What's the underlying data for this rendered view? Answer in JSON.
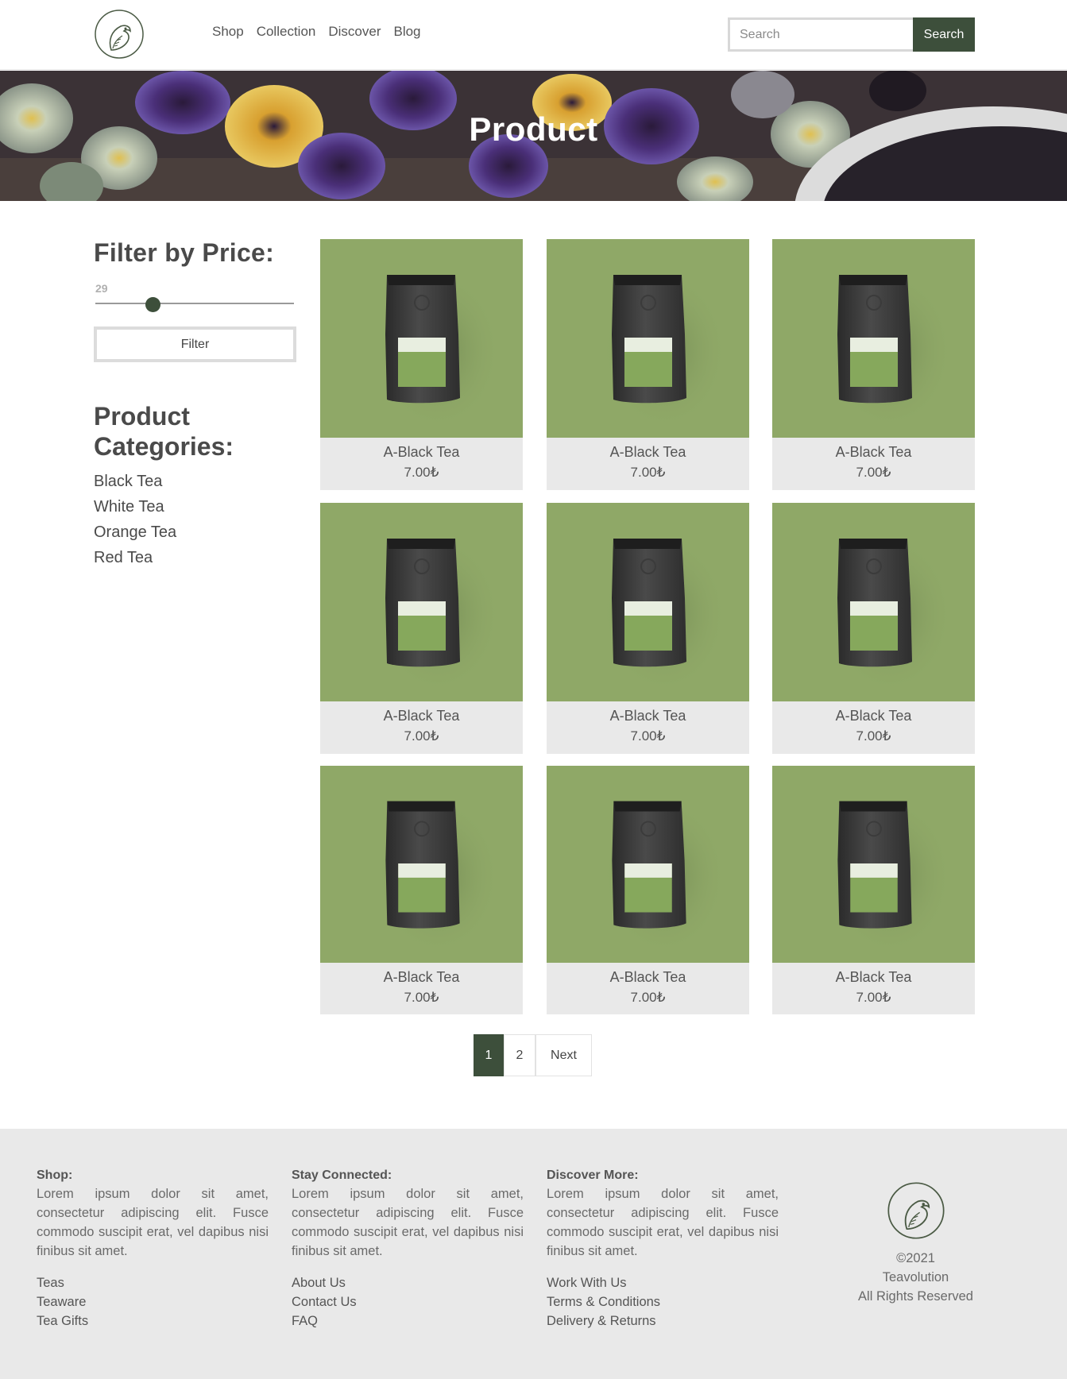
{
  "header": {
    "nav": [
      "Shop",
      "Collection",
      "Discover",
      "Blog"
    ],
    "search_placeholder": "Search",
    "search_button": "Search"
  },
  "hero": {
    "title": "Product"
  },
  "sidebar": {
    "filter_title": "Filter by Price:",
    "slider_value": "29",
    "filter_button": "Filter",
    "categories_title": "Product Categories:",
    "categories": [
      "Black Tea",
      "White Tea",
      "Orange Tea",
      "Red Tea"
    ]
  },
  "products": [
    {
      "name": "A-Black Tea",
      "price": "7.00₺"
    },
    {
      "name": "A-Black Tea",
      "price": "7.00₺"
    },
    {
      "name": "A-Black Tea",
      "price": "7.00₺"
    },
    {
      "name": "A-Black Tea",
      "price": "7.00₺"
    },
    {
      "name": "A-Black Tea",
      "price": "7.00₺"
    },
    {
      "name": "A-Black Tea",
      "price": "7.00₺"
    },
    {
      "name": "A-Black Tea",
      "price": "7.00₺"
    },
    {
      "name": "A-Black Tea",
      "price": "7.00₺"
    },
    {
      "name": "A-Black Tea",
      "price": "7.00₺"
    }
  ],
  "pagination": {
    "pages": [
      "1",
      "2"
    ],
    "next": "Next",
    "active": "1"
  },
  "footer": {
    "columns": [
      {
        "title": "Shop:",
        "text": "Lorem ipsum dolor sit amet, consectetur adipiscing elit. Fusce commodo suscipit erat, vel dapibus nisi finibus sit amet.",
        "links": [
          "Teas",
          "Teaware",
          "Tea Gifts"
        ]
      },
      {
        "title": "Stay Connected:",
        "text": "Lorem ipsum dolor sit amet, consectetur adipiscing elit. Fusce commodo suscipit erat, vel dapibus nisi finibus sit amet.",
        "links": [
          "About Us",
          "Contact Us",
          "FAQ"
        ]
      },
      {
        "title": "Discover More:",
        "text": "Lorem ipsum dolor sit amet, consectetur adipiscing elit. Fusce commodo suscipit erat, vel dapibus nisi finibus sit amet.",
        "links": [
          "Work With Us",
          "Terms & Conditions",
          "Delivery & Returns"
        ]
      }
    ],
    "copyright": "©2021",
    "brand": "Teavolution",
    "rights": "All Rights Reserved"
  },
  "colors": {
    "accent": "#3d4f3b",
    "product_bg": "#8fa867",
    "card_bg": "#e9e9e9",
    "footer_bg": "#e9e9e9"
  },
  "icons": {
    "logo": "bird-leaf-logo-icon",
    "package": "tea-bag-package-icon"
  }
}
